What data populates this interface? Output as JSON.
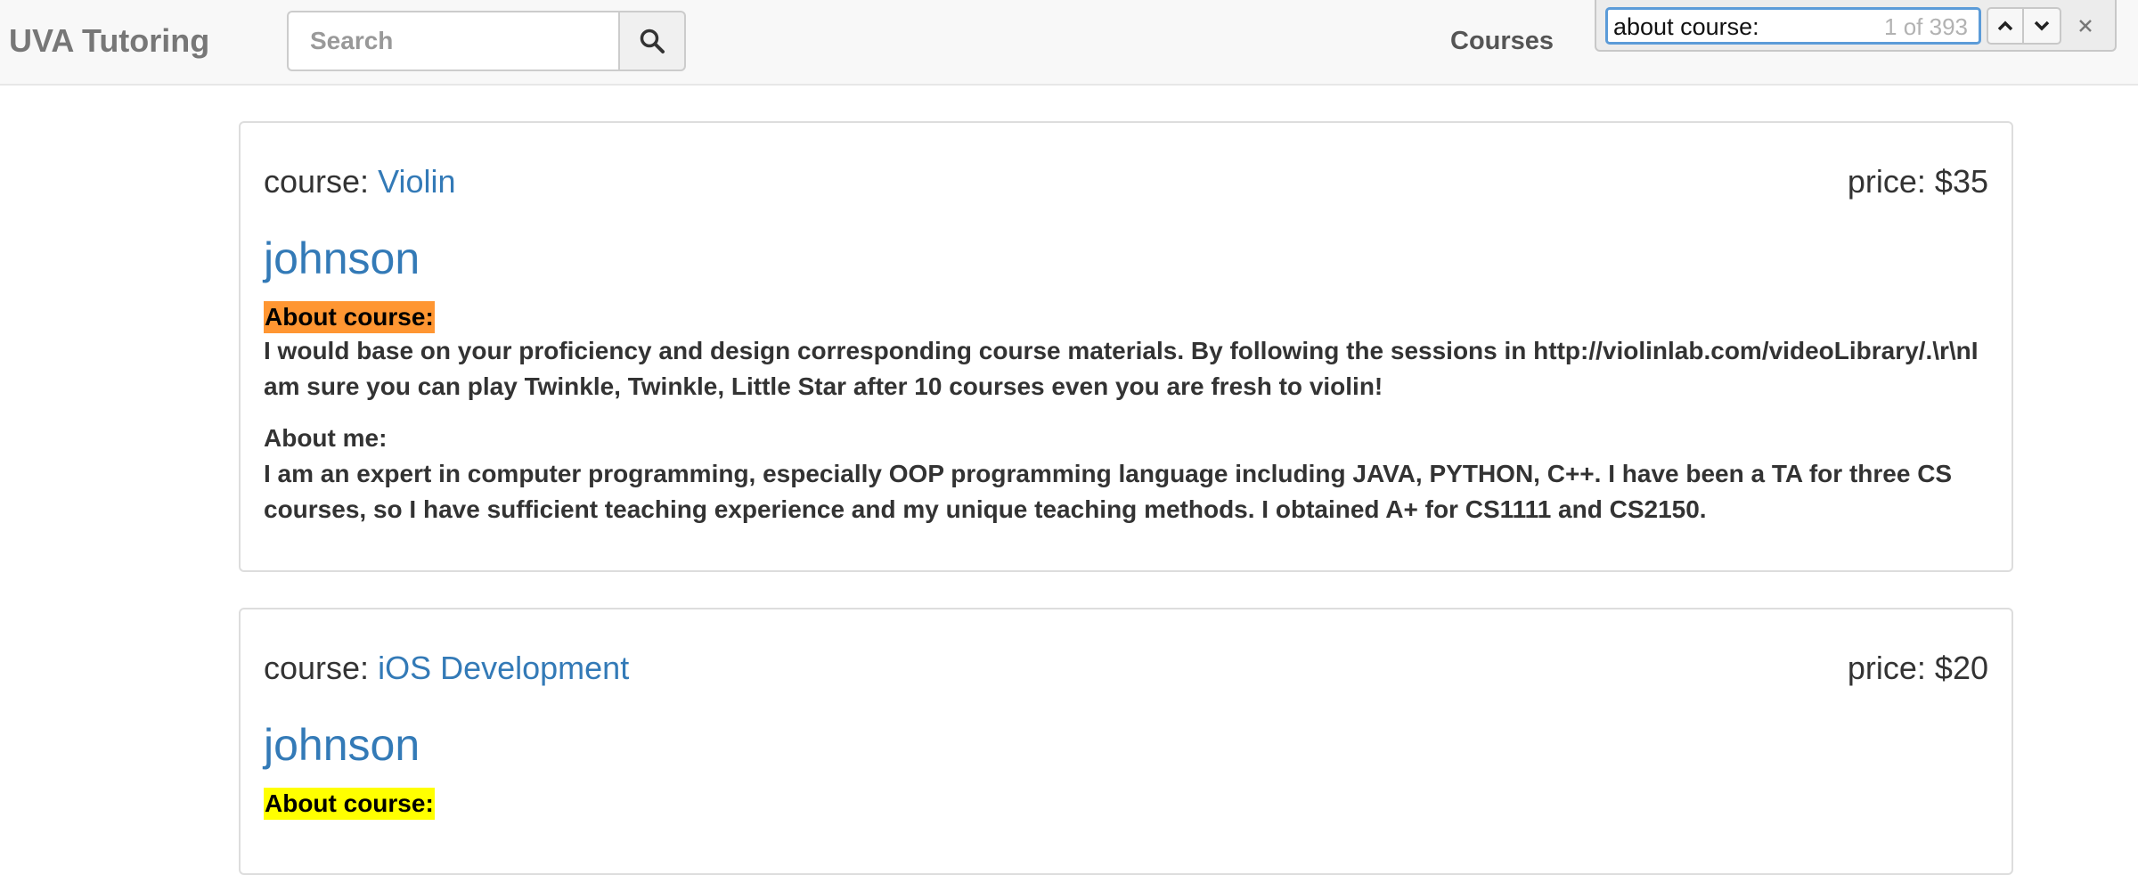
{
  "navbar": {
    "brand": "UVA Tutoring",
    "search_placeholder": "Search",
    "courses_link": "Courses"
  },
  "find_bar": {
    "query": "about course:",
    "count": "1 of 393"
  },
  "cards": [
    {
      "course_prefix": "course:",
      "course_name": "Violin",
      "price": "price: $35",
      "tutor": "johnson",
      "about_course_label": "About course:",
      "about_course_text": "I would base on your proficiency and design corresponding course materials. By following the sessions in http://violinlab.com/videoLibrary/.\\r\\nI am sure you can play Twinkle, Twinkle, Little Star after 10 courses even you are fresh to violin!",
      "about_me_label": "About me:",
      "about_me_text": "I am an expert in computer programming, especially OOP programming language including JAVA, PYTHON, C++. I have been a TA for three CS courses, so I have sufficient teaching experience and my unique teaching methods. I obtained A+ for CS1111 and CS2150."
    },
    {
      "course_prefix": "course:",
      "course_name": "iOS Development",
      "price": "price: $20",
      "tutor": "johnson",
      "about_course_label": "About course:"
    }
  ],
  "colors": {
    "link": "#337ab7",
    "current_match": "#ff9632",
    "other_match": "#ffff00"
  }
}
